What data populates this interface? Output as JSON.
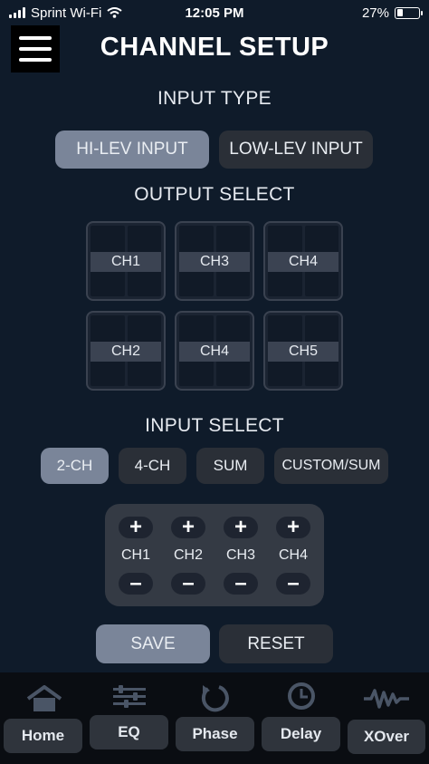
{
  "status_bar": {
    "carrier": "Sprint Wi-Fi",
    "time": "12:05 PM",
    "battery": "27%",
    "battery_level": 0.27
  },
  "header": {
    "title": "CHANNEL SETUP"
  },
  "input_type": {
    "label": "INPUT TYPE",
    "options": [
      "HI-LEV INPUT",
      "LOW-LEV INPUT"
    ],
    "selected": "HI-LEV INPUT"
  },
  "output_select": {
    "label": "OUTPUT SELECT",
    "boxes": [
      "CH1",
      "CH3",
      "CH4",
      "CH2",
      "CH4",
      "CH5"
    ]
  },
  "input_select": {
    "label": "INPUT SELECT",
    "options": [
      "2-CH",
      "4-CH",
      "SUM",
      "CUSTOM/SUM"
    ],
    "selected": "2-CH"
  },
  "mixer": {
    "plus": "+",
    "minus": "–",
    "channels": [
      "CH1",
      "CH2",
      "CH3",
      "CH4"
    ]
  },
  "actions": {
    "save": "SAVE",
    "reset": "RESET"
  },
  "tabs": [
    {
      "label": "Home",
      "icon": "home-icon"
    },
    {
      "label": "EQ",
      "icon": "equalizer-icon"
    },
    {
      "label": "Phase",
      "icon": "phase-icon"
    },
    {
      "label": "Delay",
      "icon": "clock-icon"
    },
    {
      "label": "XOver",
      "icon": "waveform-icon"
    }
  ],
  "colors": {
    "background": "#0f1b2a",
    "active_button": "#7a8599",
    "inactive_button": "#2a2f37"
  }
}
